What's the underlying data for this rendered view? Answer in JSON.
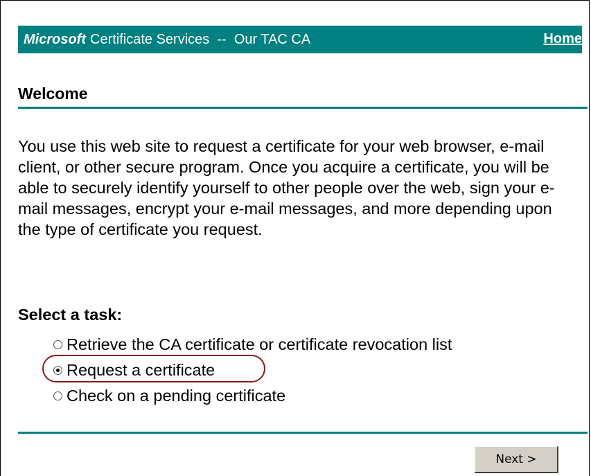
{
  "banner": {
    "brand": "Microsoft",
    "title": "Certificate Services  --  Our TAC CA",
    "home_link": "Home",
    "background_color": "#008080"
  },
  "welcome": {
    "heading": "Welcome",
    "intro": "You use this web site to request a certificate for your web browser, e-mail client, or other secure program. Once you acquire a certificate, you will be able to securely identify yourself to other people over the web, sign your e-mail messages, encrypt your e-mail messages, and more depending upon the type of certificate you request."
  },
  "tasks": {
    "heading": "Select a task:",
    "options": [
      {
        "label": "Retrieve the CA certificate or certificate revocation list",
        "selected": false
      },
      {
        "label": "Request a certificate",
        "selected": true
      },
      {
        "label": "Check on a pending certificate",
        "selected": false
      }
    ],
    "highlight_color": "#8b1a1a"
  },
  "footer": {
    "next_button": "Next >"
  }
}
